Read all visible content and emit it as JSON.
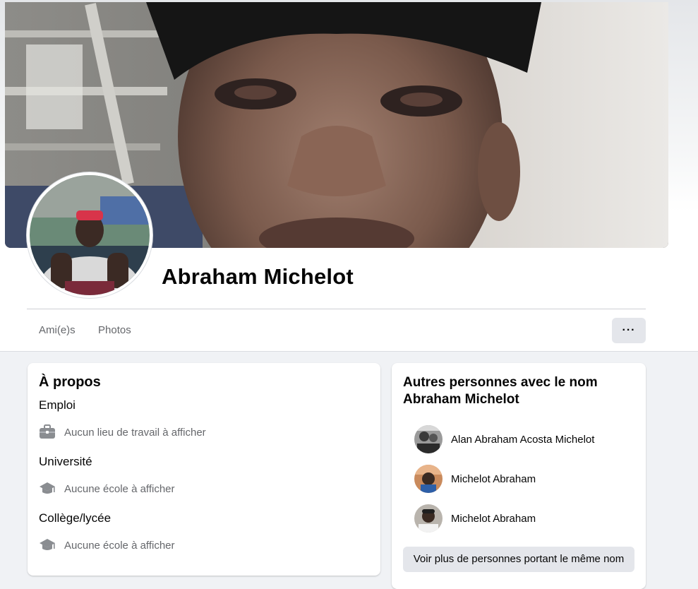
{
  "profile": {
    "name": "Abraham Michelot"
  },
  "tabs": [
    {
      "label": "Ami(e)s"
    },
    {
      "label": "Photos"
    }
  ],
  "more_button": {
    "label": "···"
  },
  "about": {
    "title": "À propos",
    "sections": [
      {
        "title": "Emploi",
        "icon": "briefcase-icon",
        "text": "Aucun lieu de travail à afficher"
      },
      {
        "title": "Université",
        "icon": "graduation-cap-icon",
        "text": "Aucune école à afficher"
      },
      {
        "title": "Collège/lycée",
        "icon": "graduation-cap-icon",
        "text": "Aucune école à afficher"
      }
    ]
  },
  "others": {
    "title": "Autres personnes avec le nom Abraham Michelot",
    "people": [
      {
        "name": "Alan Abraham Acosta Michelot"
      },
      {
        "name": "Michelot Abraham"
      },
      {
        "name": "Michelot Abraham"
      }
    ],
    "see_more_label": "Voir plus de personnes portant le même nom"
  },
  "colors": {
    "page_bg": "#f0f2f5",
    "card_bg": "#ffffff",
    "secondary_text": "#65676b",
    "button_bg": "#e4e6eb"
  }
}
